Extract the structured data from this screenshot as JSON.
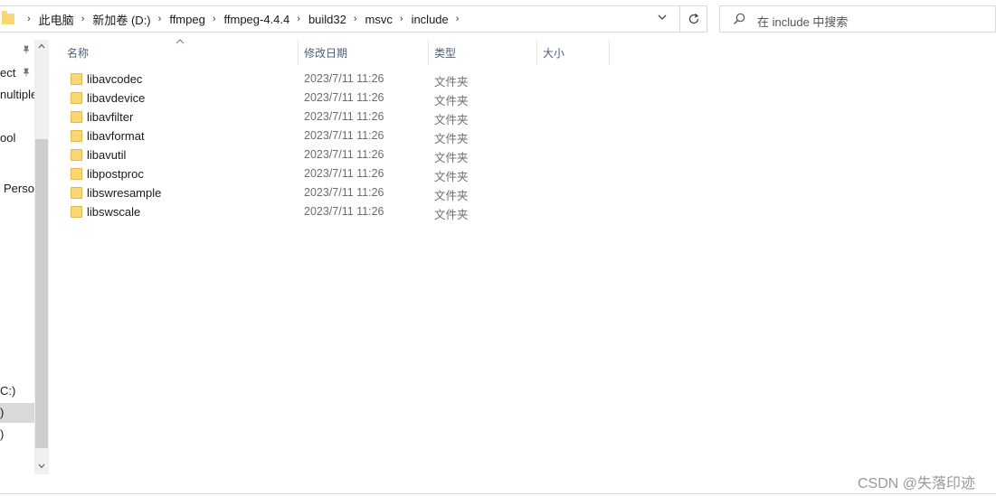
{
  "address_bar": {
    "breadcrumbs": [
      "此电脑",
      "新加卷 (D:)",
      "ffmpeg",
      "ffmpeg-4.4.4",
      "build32",
      "msvc",
      "include"
    ],
    "separator": "›",
    "dropdown_icon": "chevron-down-icon",
    "refresh_icon": "refresh-icon"
  },
  "search": {
    "placeholder": "在 include 中搜索"
  },
  "navigation": {
    "items": [
      {
        "label": "ect",
        "pinned": true
      },
      {
        "label": "nultiple",
        "pinned": false
      },
      {
        "label": "ool",
        "pinned": false
      },
      {
        "label": "Perso",
        "pinned": false
      },
      {
        "label": "C:)",
        "pinned": false
      },
      {
        "label": ")",
        "pinned": false,
        "selected": true
      },
      {
        "label": ")",
        "pinned": false
      }
    ]
  },
  "columns": {
    "name": "名称",
    "modified": "修改日期",
    "type": "类型",
    "size": "大小"
  },
  "files": [
    {
      "name": "libavcodec",
      "modified": "2023/7/11 11:26",
      "type": "文件夹"
    },
    {
      "name": "libavdevice",
      "modified": "2023/7/11 11:26",
      "type": "文件夹"
    },
    {
      "name": "libavfilter",
      "modified": "2023/7/11 11:26",
      "type": "文件夹"
    },
    {
      "name": "libavformat",
      "modified": "2023/7/11 11:26",
      "type": "文件夹"
    },
    {
      "name": "libavutil",
      "modified": "2023/7/11 11:26",
      "type": "文件夹"
    },
    {
      "name": "libpostproc",
      "modified": "2023/7/11 11:26",
      "type": "文件夹"
    },
    {
      "name": "libswresample",
      "modified": "2023/7/11 11:26",
      "type": "文件夹"
    },
    {
      "name": "libswscale",
      "modified": "2023/7/11 11:26",
      "type": "文件夹"
    }
  ],
  "watermark": "CSDN @失落印迹",
  "colors": {
    "folder": "#f8d775",
    "header_text": "#4c607a",
    "meta_text": "#6d6d6d"
  }
}
